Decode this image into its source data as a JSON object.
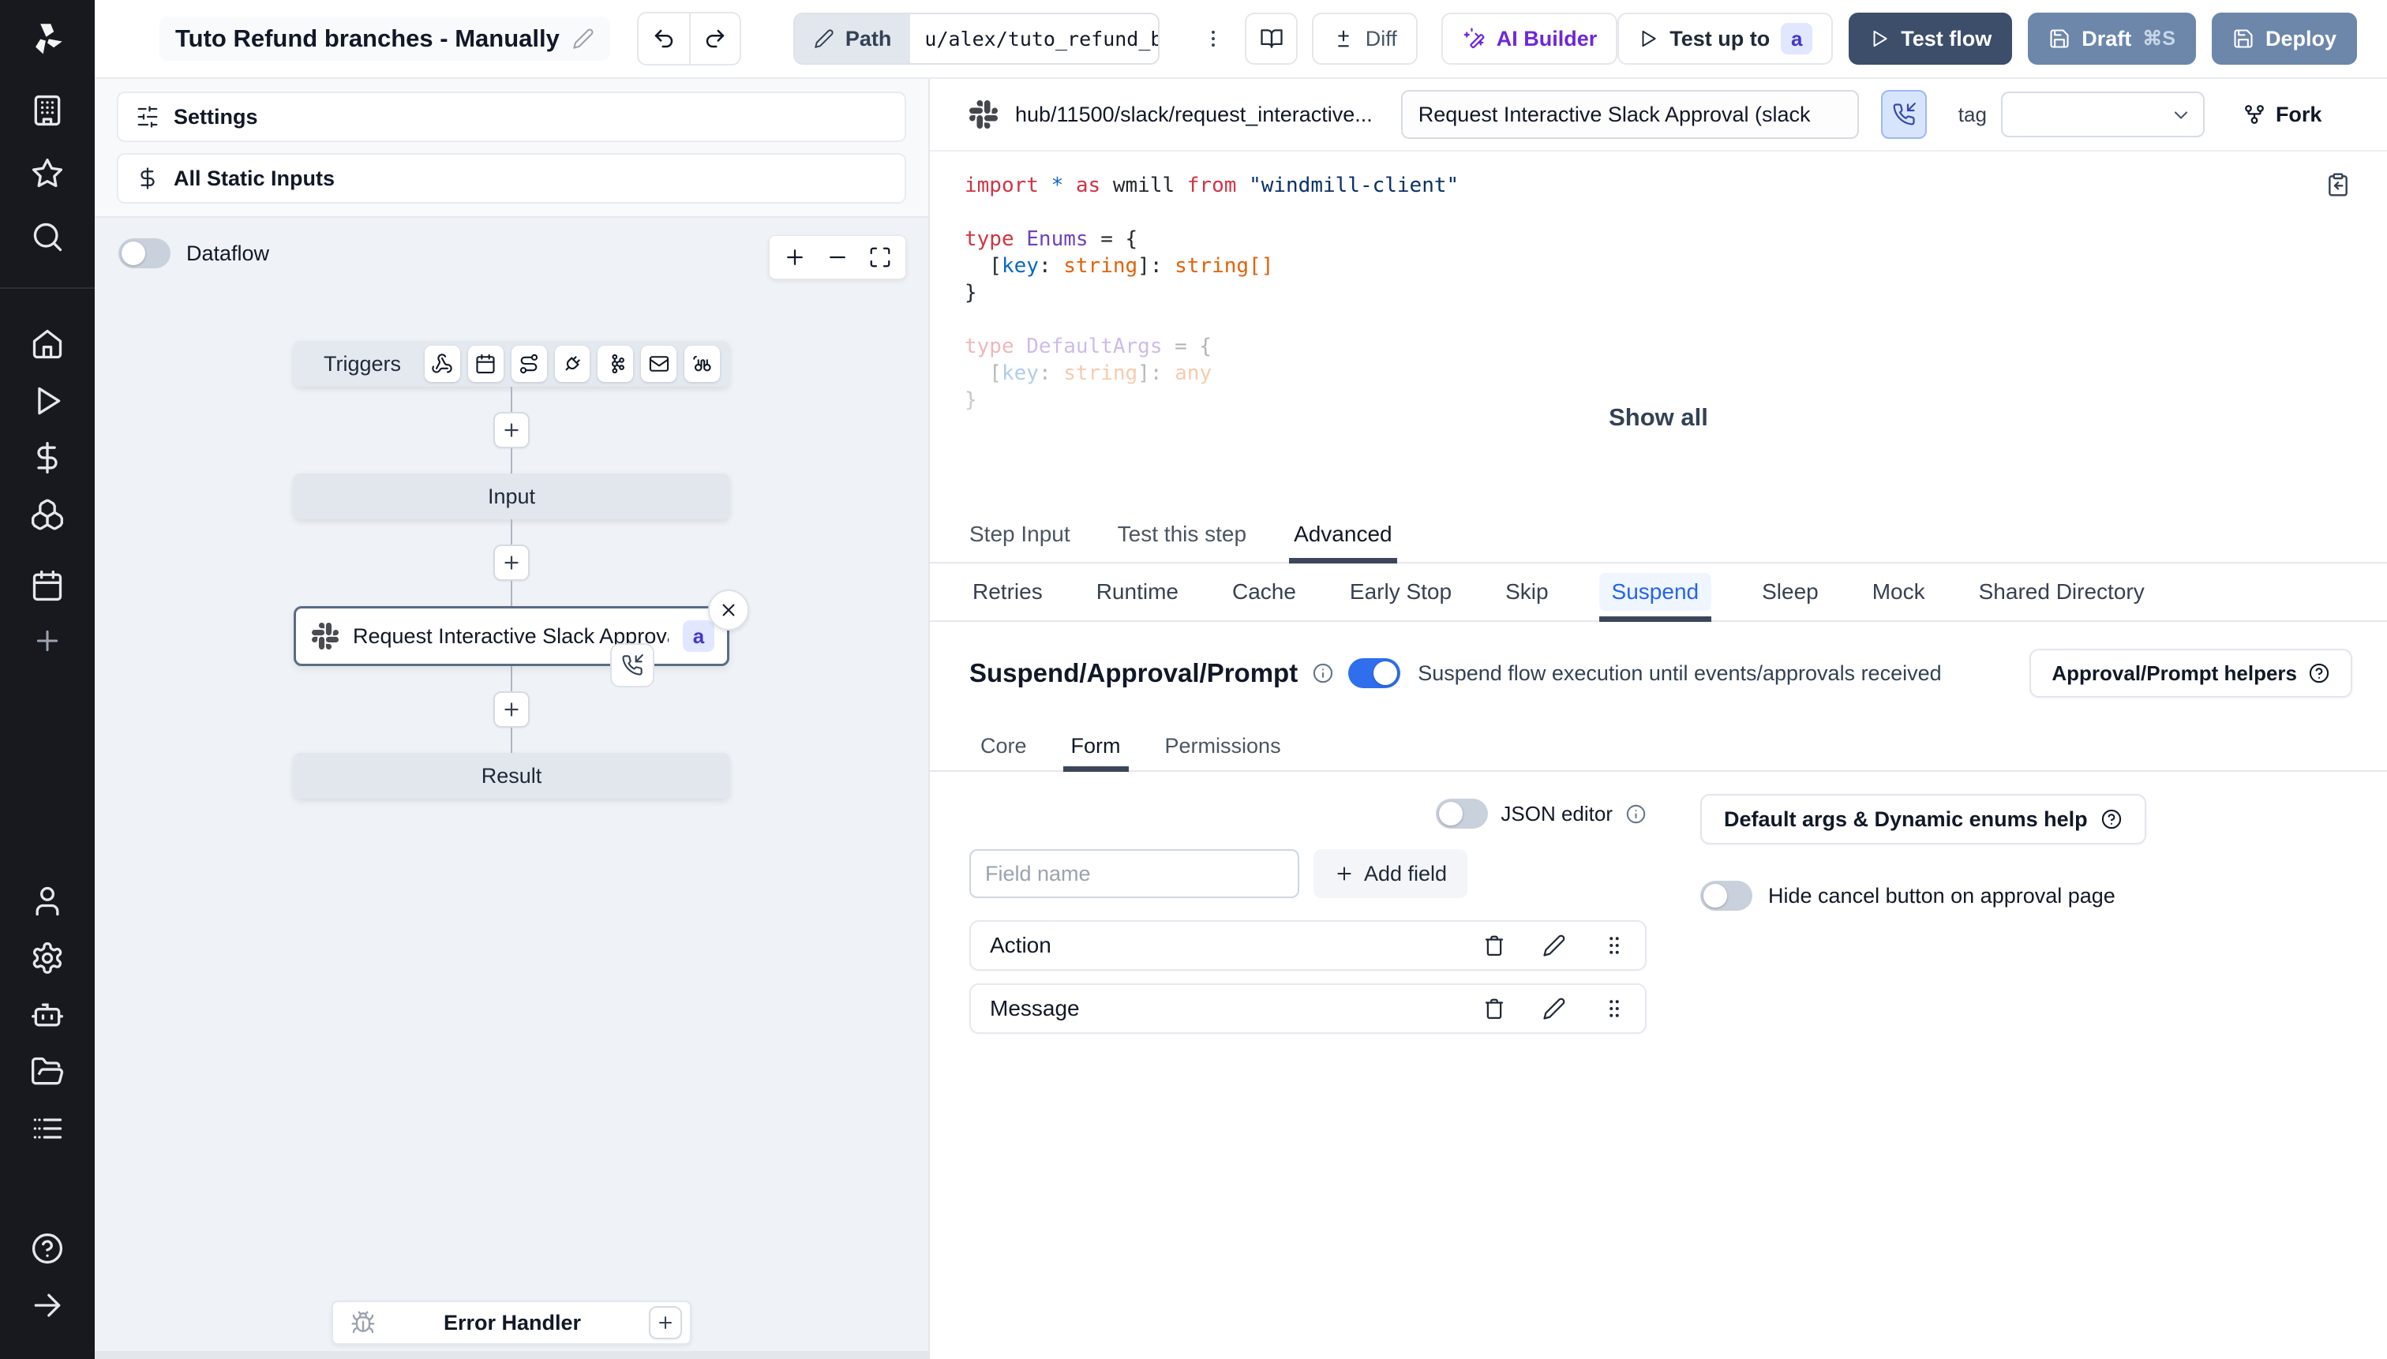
{
  "header": {
    "title": "Tuto Refund branches - Manually",
    "path_label": "Path",
    "path_value": "u/alex/tuto_refund_branches__",
    "diff": "Diff",
    "ai_builder": "AI Builder",
    "test_up_to": "Test up to",
    "test_badge": "a",
    "test_flow": "Test flow",
    "draft": "Draft",
    "draft_shortcut": "⌘S",
    "deploy": "Deploy"
  },
  "sidebar": {
    "icons": [
      "windmill-logo",
      "building",
      "star",
      "search",
      "home",
      "play",
      "dollar",
      "boxes",
      "calendar",
      "plus",
      "user",
      "gear",
      "robot",
      "folder-open",
      "audit-list",
      "help-circle",
      "arrow-right"
    ]
  },
  "flow": {
    "settings": "Settings",
    "all_static_inputs": "All Static Inputs",
    "dataflow": "Dataflow",
    "triggers_label": "Triggers",
    "trigger_icons": [
      "webhook",
      "schedule",
      "http-route",
      "websocket",
      "kafka",
      "email",
      "scheduled-poll"
    ],
    "input_label": "Input",
    "step": {
      "label": "Request Interactive Slack Approval (...",
      "badge": "a"
    },
    "result_label": "Result",
    "error_handler": "Error Handler"
  },
  "step": {
    "hub_path": "hub/11500/slack/request_interactive...",
    "name": "Request Interactive Slack Approval (slack",
    "tag_label": "tag",
    "fork": "Fork",
    "show_all": "Show all",
    "tabs": [
      "Step Input",
      "Test this step",
      "Advanced"
    ],
    "active_tab": "Advanced",
    "subtabs": [
      "Retries",
      "Runtime",
      "Cache",
      "Early Stop",
      "Skip",
      "Suspend",
      "Sleep",
      "Mock",
      "Shared Directory"
    ],
    "active_subtab": "Suspend"
  },
  "code": {
    "l1": [
      "import ",
      "* ",
      "as ",
      "wmill ",
      "from ",
      "\"windmill-client\""
    ],
    "l3": [
      "type ",
      "Enums ",
      "= {"
    ],
    "l4": [
      "  [",
      "key",
      ": ",
      "string",
      "]: ",
      "string[]"
    ],
    "l5": [
      "}"
    ],
    "l7": [
      "type ",
      "DefaultArgs ",
      "= {"
    ],
    "l8": [
      "  [",
      "key",
      ": ",
      "string",
      "]: ",
      "any"
    ],
    "l9": [
      "}"
    ]
  },
  "suspend": {
    "title": "Suspend/Approval/Prompt",
    "toggle_on": true,
    "description": "Suspend flow execution until events/approvals received",
    "helpers": "Approval/Prompt helpers",
    "tabs": [
      "Core",
      "Form",
      "Permissions"
    ],
    "active_tab": "Form",
    "json_editor": "JSON editor",
    "field_placeholder": "Field name",
    "add_field": "Add field",
    "default_args_help": "Default args & Dynamic enums help",
    "hide_cancel": "Hide cancel button on approval page",
    "fields": [
      "Action",
      "Message"
    ]
  },
  "colors": {
    "accent_blue": "#2f6fed",
    "suspend_tab_blue": "#2563eb",
    "badge_bg": "#e0e7ff",
    "badge_text": "#4338ca",
    "ai_purple": "#6d28d9",
    "test_flow_bg": "#3d4e6a",
    "draft_deploy_bg": "#6d87aa",
    "rail_bg": "#17191f",
    "canvas_bg": "#eff2f6"
  }
}
